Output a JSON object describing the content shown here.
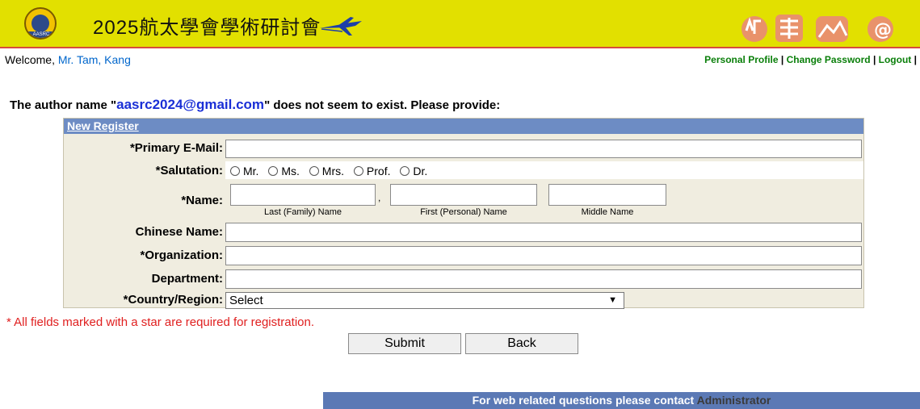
{
  "header": {
    "title": "2025航太學會學術研討會",
    "logo_text": "AASRC",
    "colors": {
      "banner": "#e2e000",
      "accent_line": "#d84a3e"
    }
  },
  "userbar": {
    "welcome": "Welcome, ",
    "user_name": "Mr. Tam, Kang",
    "links": [
      "Personal Profile",
      "Change Password",
      "Logout"
    ],
    "separator": " | "
  },
  "notice": {
    "prefix": "The author name \"",
    "email": "aasrc2024@gmail.com",
    "suffix": "\" does not seem to exist. Please provide:"
  },
  "form": {
    "section_title": "New Register",
    "labels": {
      "primary_email": "*Primary E-Mail:",
      "salutation": "*Salutation:",
      "name": "*Name:",
      "chinese_name": "Chinese Name:",
      "organization": "*Organization:",
      "department": "Department:",
      "country": "*Country/Region:"
    },
    "salutation_options": [
      "Mr.",
      "Ms.",
      "Mrs.",
      "Prof.",
      "Dr."
    ],
    "name_sublabels": {
      "last": "Last (Family) Name",
      "first": "First (Personal) Name",
      "middle": "Middle Name"
    },
    "name_separator": ",",
    "country_selected": "Select",
    "values": {
      "primary_email": "",
      "last_name": "",
      "first_name": "",
      "middle_name": "",
      "chinese_name": "",
      "organization": "",
      "department": ""
    }
  },
  "required_note": "* All fields marked with a star are required for registration.",
  "buttons": {
    "submit": "Submit",
    "back": "Back"
  },
  "footer": {
    "text": "For web related questions please contact ",
    "link": "Administrator"
  }
}
